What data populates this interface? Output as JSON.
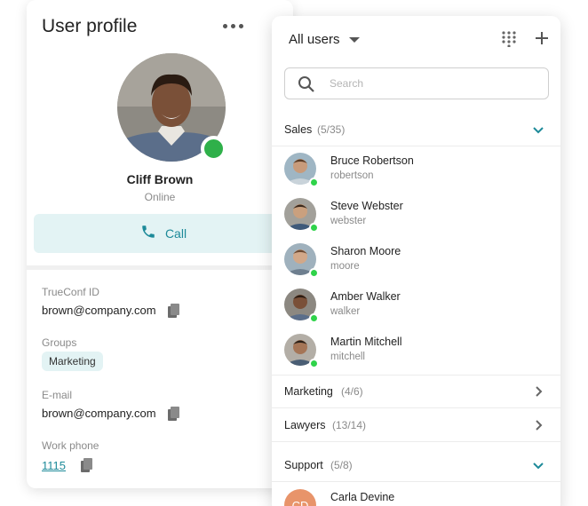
{
  "profile": {
    "title": "User profile",
    "name": "Cliff Brown",
    "status": "Online",
    "call_label": "Call",
    "fields": {
      "trueconf_label": "TrueConf ID",
      "trueconf_value": "brown@company.com",
      "groups_label": "Groups",
      "groups_value": "Marketing",
      "email_label": "E-mail",
      "email_value": "brown@company.com",
      "phone_label": "Work phone",
      "phone_value": "1115"
    }
  },
  "users_panel": {
    "title": "All users",
    "search_placeholder": "Search",
    "groups": [
      {
        "name": "Sales",
        "count": "(5/35)",
        "expanded": true
      },
      {
        "name": "Marketing",
        "count": "(4/6)",
        "expanded": false
      },
      {
        "name": "Lawyers",
        "count": "(13/14)",
        "expanded": false
      },
      {
        "name": "Support",
        "count": "(5/8)",
        "expanded": true
      }
    ],
    "sales_users": [
      {
        "name": "Bruce Robertson",
        "login": "robertson"
      },
      {
        "name": "Steve Webster",
        "login": "webster"
      },
      {
        "name": "Sharon Moore",
        "login": "moore"
      },
      {
        "name": "Amber Walker",
        "login": "walker"
      },
      {
        "name": "Martin Mitchell",
        "login": "mitchell"
      }
    ],
    "support_users": [
      {
        "name": "Carla Devine",
        "initials": "CD"
      }
    ]
  },
  "colors": {
    "accent": "#1d8a99",
    "online": "#2fb04a",
    "chip_bg": "#e3f3f4"
  }
}
